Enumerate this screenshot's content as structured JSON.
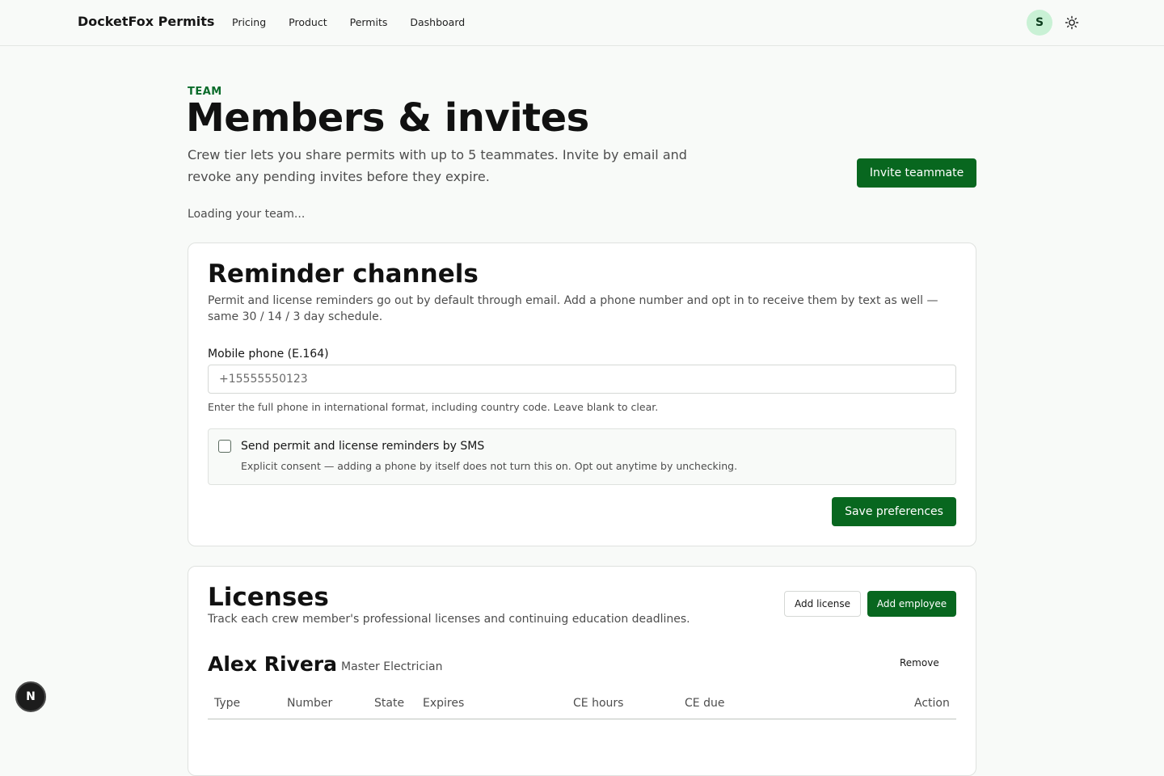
{
  "header": {
    "brand": "DocketFox Permits",
    "nav": [
      "Pricing",
      "Product",
      "Permits",
      "Dashboard"
    ],
    "avatar_initial": "S",
    "theme_icon": "sun-icon"
  },
  "page": {
    "eyebrow": "TEAM",
    "title": "Members & invites",
    "description": "Crew tier lets you share permits with up to 5 teammates. Invite by email and revoke any pending invites before they expire.",
    "invite_button": "Invite teammate",
    "loading_text": "Loading your team..."
  },
  "reminders": {
    "title": "Reminder channels",
    "description": "Permit and license reminders go out by default through email. Add a phone number and opt in to receive them by text as well — same 30 / 14 / 3 day schedule.",
    "phone_label": "Mobile phone (E.164)",
    "phone_value": "",
    "phone_placeholder": "+15555550123",
    "phone_help": "Enter the full phone in international format, including country code. Leave blank to clear.",
    "sms_label": "Send permit and license reminders by SMS",
    "sms_sub": "Explicit consent — adding a phone by itself does not turn this on. Opt out anytime by unchecking.",
    "sms_checked": false,
    "save_button": "Save preferences"
  },
  "licenses": {
    "title": "Licenses",
    "description": "Track each crew member's professional licenses and continuing education deadlines.",
    "add_license_button": "Add license",
    "add_employee_button": "Add employee",
    "employee": {
      "name": "Alex Rivera",
      "role": "Master Electrician",
      "remove_button": "Remove"
    },
    "columns": [
      "Type",
      "Number",
      "State",
      "Expires",
      "CE hours",
      "CE due",
      "Action"
    ]
  },
  "floating_badge": "N",
  "colors": {
    "accent": "#08671f",
    "eyebrow": "#096b2a",
    "avatar_bg": "#c9f1d5"
  }
}
